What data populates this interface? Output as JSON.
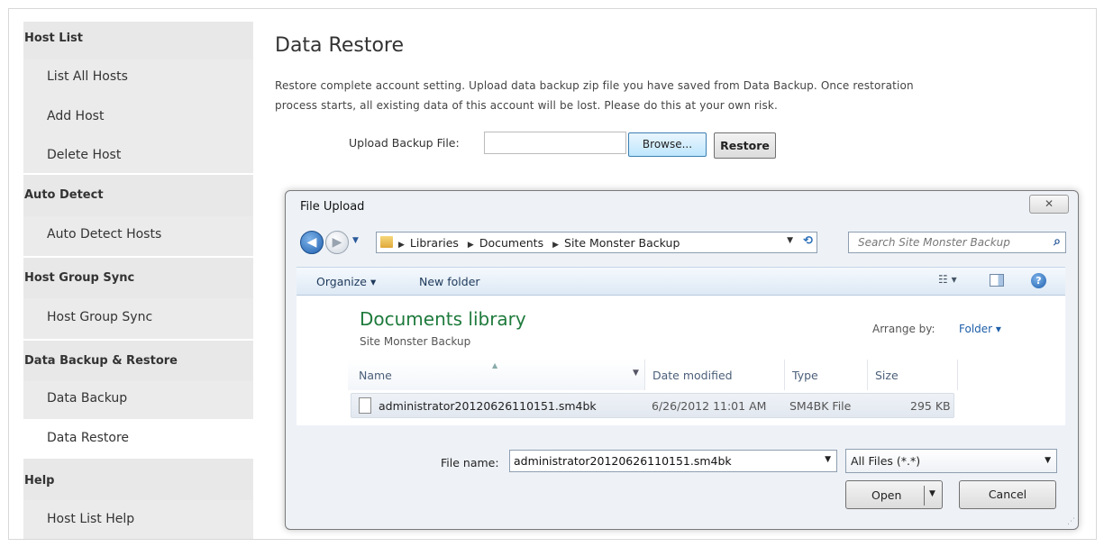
{
  "sidebar": {
    "sections": [
      {
        "title": "Host List",
        "items": [
          "List All Hosts",
          "Add Host",
          "Delete Host"
        ]
      },
      {
        "title": "Auto Detect",
        "items": [
          "Auto Detect Hosts"
        ]
      },
      {
        "title": "Host Group Sync",
        "items": [
          "Host Group Sync"
        ]
      },
      {
        "title": "Data Backup & Restore",
        "items": [
          "Data Backup",
          "Data Restore"
        ]
      },
      {
        "title": "Help",
        "items": [
          "Host List Help"
        ]
      }
    ],
    "active_item": "Data Restore"
  },
  "main": {
    "title": "Data Restore",
    "description": "Restore complete account setting. Upload data backup zip file you have saved from Data Backup. Once restoration process starts, all existing data of this account will be lost. Please do this at your own risk.",
    "upload_label": "Upload Backup File:",
    "upload_value": "",
    "browse_label": "Browse...",
    "restore_label": "Restore"
  },
  "dialog": {
    "title": "File Upload",
    "close_glyph": "✕",
    "breadcrumbs": [
      "Libraries",
      "Documents",
      "Site Monster Backup"
    ],
    "search_placeholder": "Search Site Monster Backup",
    "toolbar": {
      "organize": "Organize ▾",
      "new_folder": "New folder",
      "views": "☷ ▾",
      "help": "?"
    },
    "library_title": "Documents library",
    "library_subtitle": "Site Monster Backup",
    "arrange_label": "Arrange by:",
    "arrange_value": "Folder ▾",
    "columns": {
      "name": "Name",
      "date": "Date modified",
      "type": "Type",
      "size": "Size"
    },
    "files": [
      {
        "name": "administrator20120626110151.sm4bk",
        "date": "6/26/2012 11:01 AM",
        "type": "SM4BK File",
        "size": "295 KB"
      }
    ],
    "file_name_label": "File name:",
    "file_name_value": "administrator20120626110151.sm4bk",
    "filter_value": "All Files (*.*)",
    "open_label": "Open",
    "cancel_label": "Cancel"
  },
  "colors": {
    "sidebar_bg": "#ebebeb",
    "library_title": "#1e7a3c",
    "link_blue": "#1e5fa8"
  }
}
